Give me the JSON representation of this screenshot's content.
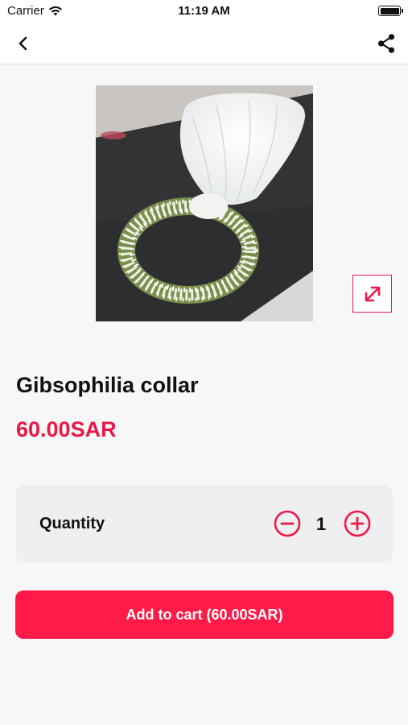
{
  "status_bar": {
    "carrier": "Carrier",
    "time": "11:19 AM",
    "icons": [
      "wifi-icon",
      "battery-icon"
    ]
  },
  "nav": {
    "back_icon": "chevron-left-icon",
    "share_icon": "share-icon"
  },
  "product": {
    "image": "gypsophila-flower-crown-with-veil-photo",
    "expand_icon": "expand-icon",
    "title": "Gibsophilia collar",
    "price": "60.00SAR"
  },
  "quantity": {
    "label": "Quantity",
    "value": "1",
    "minus_icon": "minus-circle-icon",
    "plus_icon": "plus-circle-icon"
  },
  "cart_button": {
    "label": "Add to cart (60.00SAR)"
  },
  "colors": {
    "accent": "#ff1a47",
    "price": "#e8194a",
    "card_background": "#efeef1",
    "page_background": "#f7f7f7"
  }
}
